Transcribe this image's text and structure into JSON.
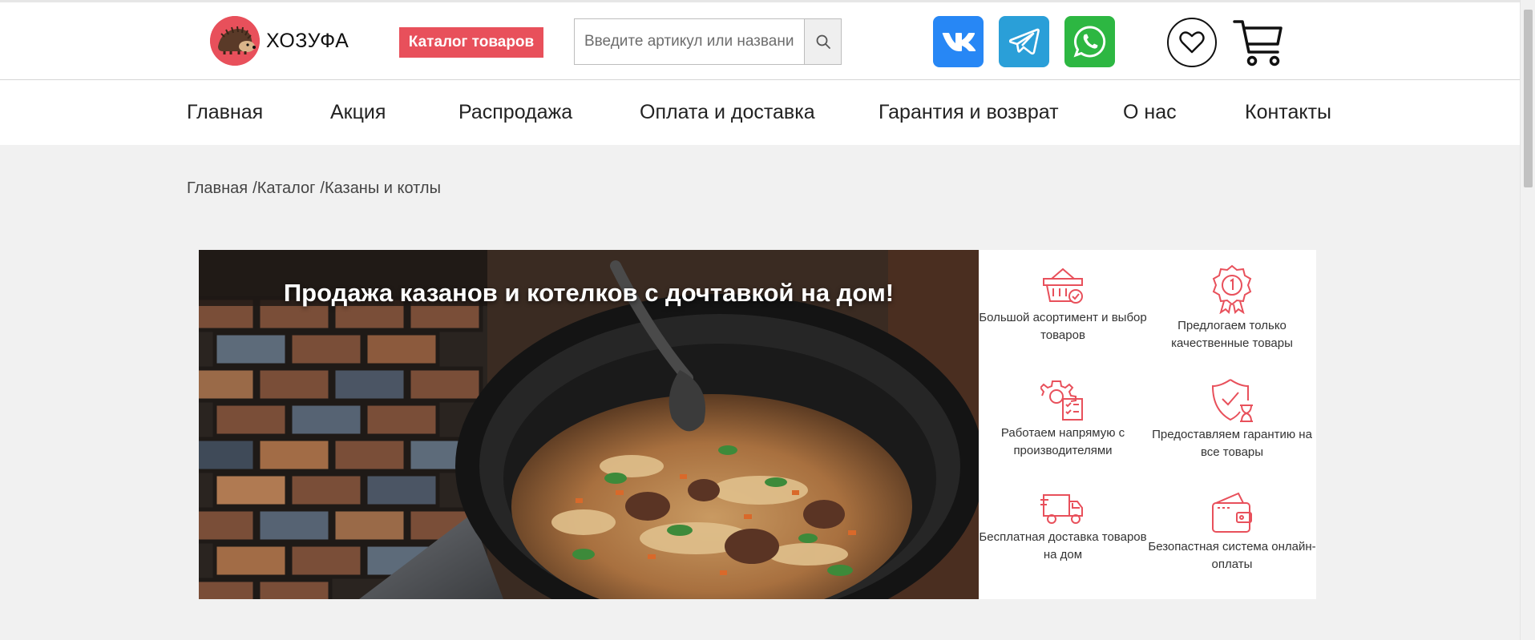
{
  "header": {
    "logo_text": "ХОЗУФА",
    "catalog_button": "Каталог товаров",
    "search_placeholder": "Введите артикул или название",
    "colors": {
      "accent": "#e8505b",
      "vk": "#2787f5",
      "telegram": "#2a9fd8",
      "whatsapp": "#2db742"
    },
    "icons": [
      "logo-hedgehog",
      "search-icon",
      "vk-icon",
      "telegram-icon",
      "whatsapp-icon",
      "heart-icon",
      "cart-icon"
    ]
  },
  "nav": {
    "items": [
      {
        "label": "Главная"
      },
      {
        "label": "Акция"
      },
      {
        "label": "Распродажа"
      },
      {
        "label": "Оплата и доставка"
      },
      {
        "label": "Гарантия и возврат"
      },
      {
        "label": "О нас"
      },
      {
        "label": "Контакты"
      }
    ]
  },
  "breadcrumb": {
    "items": [
      "Главная",
      "Каталог",
      "Казаны и котлы"
    ],
    "separator": "/"
  },
  "banner": {
    "title": "Продажа казанов и котелков с дочтавкой на дом!"
  },
  "features": [
    {
      "icon": "basket-icon",
      "text": "Большой асортимент и выбор товаров"
    },
    {
      "icon": "award-icon",
      "text": "Предлогаем только качественные товары"
    },
    {
      "icon": "gear-checklist-icon",
      "text": "Работаем напрямую с производителями"
    },
    {
      "icon": "shield-hourglass-icon",
      "text": "Предоставляем гарантию на все товары"
    },
    {
      "icon": "truck-icon",
      "text": "Бесплатная доставка товаров на дом"
    },
    {
      "icon": "wallet-icon",
      "text": "Безопастная система онлайн-оплаты"
    }
  ]
}
